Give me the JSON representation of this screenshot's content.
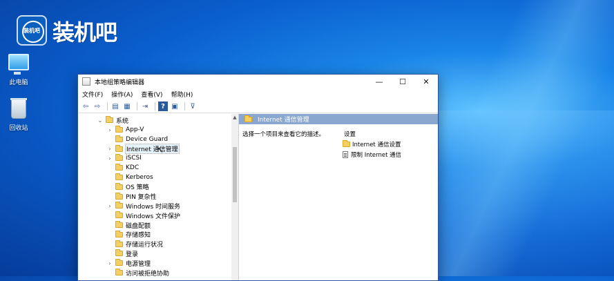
{
  "brand": {
    "badge": "装机吧",
    "name": "装机吧"
  },
  "desktop_icons": [
    {
      "label": "此电脑"
    },
    {
      "label": "回收站"
    }
  ],
  "window": {
    "title": "本地组策略编辑器",
    "controls": {
      "minimize": "—",
      "maximize": "☐",
      "close": "✕"
    },
    "menu": [
      "文件(F)",
      "操作(A)",
      "查看(V)",
      "帮助(H)"
    ]
  },
  "tree": {
    "root": "系统",
    "items": [
      {
        "label": "App-V",
        "expandable": true
      },
      {
        "label": "Device Guard",
        "expandable": false
      },
      {
        "label": "Internet 通信管理",
        "expandable": true,
        "selected": true
      },
      {
        "label": "iSCSI",
        "expandable": true
      },
      {
        "label": "KDC",
        "expandable": false
      },
      {
        "label": "Kerberos",
        "expandable": false
      },
      {
        "label": "OS 策略",
        "expandable": false
      },
      {
        "label": "PIN 复杂性",
        "expandable": false
      },
      {
        "label": "Windows 时间服务",
        "expandable": true
      },
      {
        "label": "Windows 文件保护",
        "expandable": false
      },
      {
        "label": "磁盘配额",
        "expandable": false
      },
      {
        "label": "存储感知",
        "expandable": false
      },
      {
        "label": "存储运行状况",
        "expandable": false
      },
      {
        "label": "登录",
        "expandable": false
      },
      {
        "label": "电源管理",
        "expandable": true
      },
      {
        "label": "访问被拒绝协助",
        "expandable": false
      }
    ]
  },
  "detail": {
    "header": "Internet 通信管理",
    "description": "选择一个项目来查看它的描述。",
    "list_header": "设置",
    "items": [
      {
        "label": "Internet 通信设置",
        "type": "folder"
      },
      {
        "label": "限制 Internet 通信",
        "type": "setting"
      }
    ]
  }
}
